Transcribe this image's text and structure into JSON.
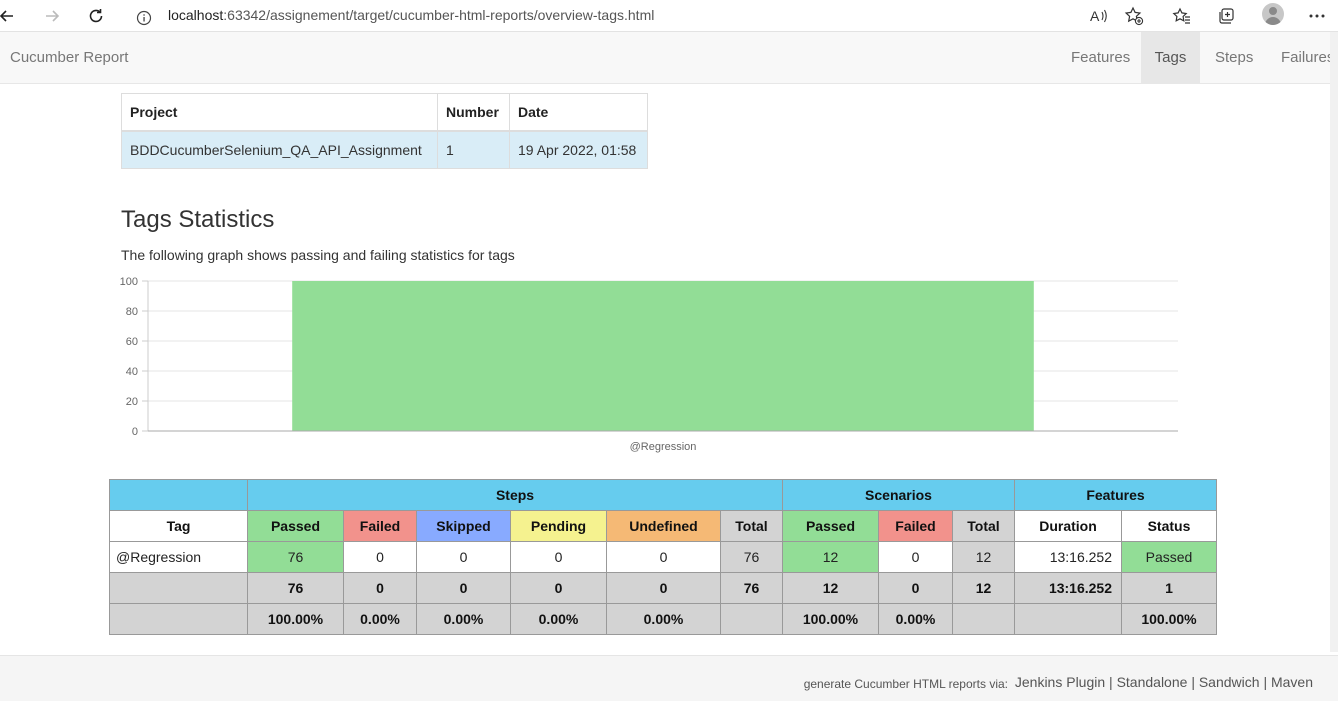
{
  "browser": {
    "url_host": "localhost",
    "url_path": ":63342/assignement/target/cucumber-html-reports/overview-tags.html"
  },
  "navbar": {
    "brand": "Cucumber Report",
    "items": [
      {
        "label": "Features",
        "active": false
      },
      {
        "label": "Tags",
        "active": true
      },
      {
        "label": "Steps",
        "active": false
      },
      {
        "label": "Failures",
        "active": false
      }
    ]
  },
  "project_table": {
    "headers": [
      "Project",
      "Number",
      "Date"
    ],
    "row": [
      "BDDCucumberSelenium_QA_API_Assignment",
      "1",
      "19 Apr 2022, 01:58"
    ]
  },
  "section": {
    "title": "Tags Statistics",
    "subtitle": "The following graph shows passing and failing statistics for tags"
  },
  "chart_data": {
    "type": "bar",
    "categories": [
      "@Regression"
    ],
    "series": [
      {
        "values": [
          100
        ],
        "color": "#92dd96"
      }
    ],
    "ylim": [
      0,
      100
    ],
    "yticks": [
      "0",
      "20",
      "40",
      "60",
      "80",
      "100"
    ],
    "grid": true
  },
  "stats_table": {
    "groups": [
      "",
      "Steps",
      "Scenarios",
      "Features"
    ],
    "headers": [
      "Tag",
      "Passed",
      "Failed",
      "Skipped",
      "Pending",
      "Undefined",
      "Total",
      "Passed",
      "Failed",
      "Total",
      "Duration",
      "Status"
    ],
    "row": {
      "tag": "@Regression",
      "steps_passed": "76",
      "steps_failed": "0",
      "steps_skipped": "0",
      "steps_pending": "0",
      "steps_undefined": "0",
      "steps_total": "76",
      "sc_passed": "12",
      "sc_failed": "0",
      "sc_total": "12",
      "duration": "13:16.252",
      "status": "Passed"
    },
    "totals": [
      "",
      "76",
      "0",
      "0",
      "0",
      "0",
      "76",
      "12",
      "0",
      "12",
      "13:16.252",
      "1"
    ],
    "percents": [
      "",
      "100.00%",
      "0.00%",
      "0.00%",
      "0.00%",
      "0.00%",
      "",
      "100.00%",
      "0.00%",
      "",
      "",
      "100.00%"
    ]
  },
  "footer": {
    "text": "generate Cucumber HTML reports via:",
    "links": [
      "Jenkins Plugin",
      "Standalone",
      "Sandwich",
      "Maven"
    ],
    "separator": "|"
  },
  "colors": {
    "passed": "#92dd96",
    "failed": "#f2928c",
    "skipped": "#88aaff",
    "pending": "#f5f28f",
    "undefined": "#f5b975",
    "header_group": "#66ccee"
  }
}
